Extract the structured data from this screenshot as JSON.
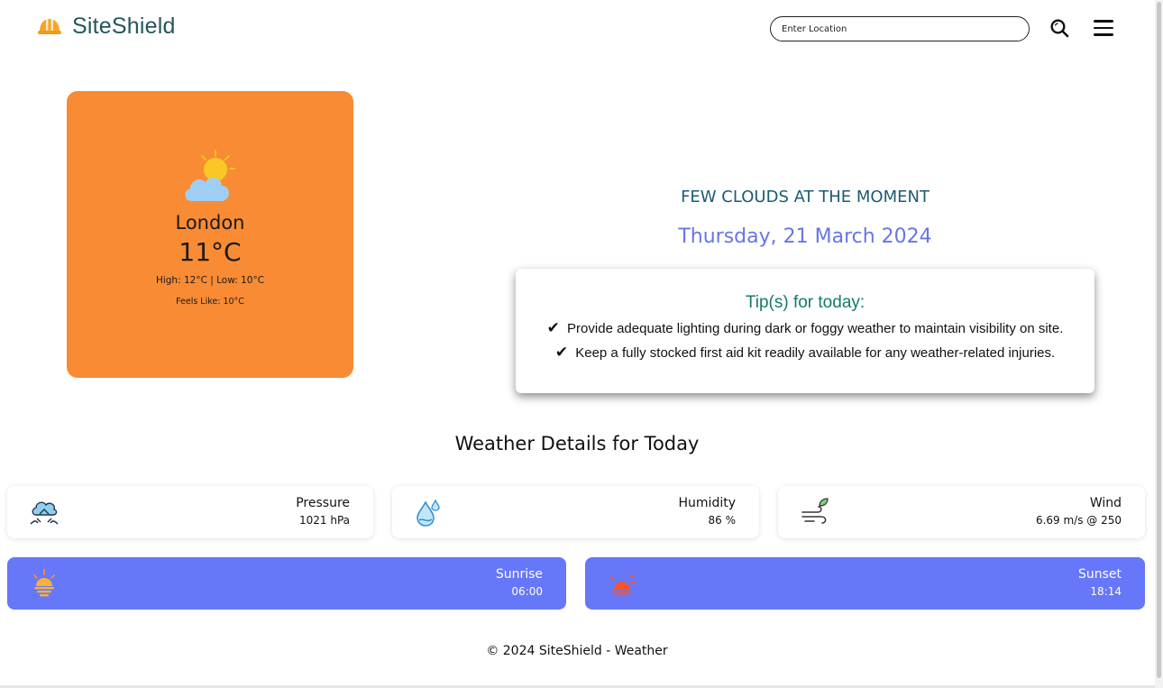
{
  "header": {
    "brand_name": "SiteShield",
    "search_placeholder": "Enter Location",
    "brand_color": "#25575a"
  },
  "current": {
    "city": "London",
    "temperature": "11°C",
    "high_low": "High: 12°C | Low: 10°C",
    "feels_like": "Feels Like: 10°C",
    "icon": "sun-behind-cloud-icon",
    "card_color": "#f98b34"
  },
  "summary": {
    "description": "FEW CLOUDS AT THE MOMENT",
    "date": "Thursday, 21 March 2024"
  },
  "tips": {
    "title": "Tip(s) for today:",
    "items": [
      "Provide adequate lighting during dark or foggy weather to maintain visibility on site.",
      "Keep a fully stocked first aid kit readily available for any weather-related injuries."
    ],
    "check_glyph": "✔"
  },
  "details": {
    "title": "Weather Details for Today",
    "pressure": {
      "label": "Pressure",
      "value": "1021 hPa",
      "icon": "pressure-icon"
    },
    "humidity": {
      "label": "Humidity",
      "value": "86 %",
      "icon": "humidity-icon"
    },
    "wind": {
      "label": "Wind",
      "value": "6.69 m/s @ 250",
      "icon": "wind-icon"
    },
    "sunrise": {
      "label": "Sunrise",
      "value": "06:00",
      "icon": "sunrise-icon"
    },
    "sunset": {
      "label": "Sunset",
      "value": "18:14",
      "icon": "sunset-icon"
    },
    "accent_color": "#6777f9"
  },
  "footer": {
    "text": "© 2024 SiteShield - Weather"
  }
}
